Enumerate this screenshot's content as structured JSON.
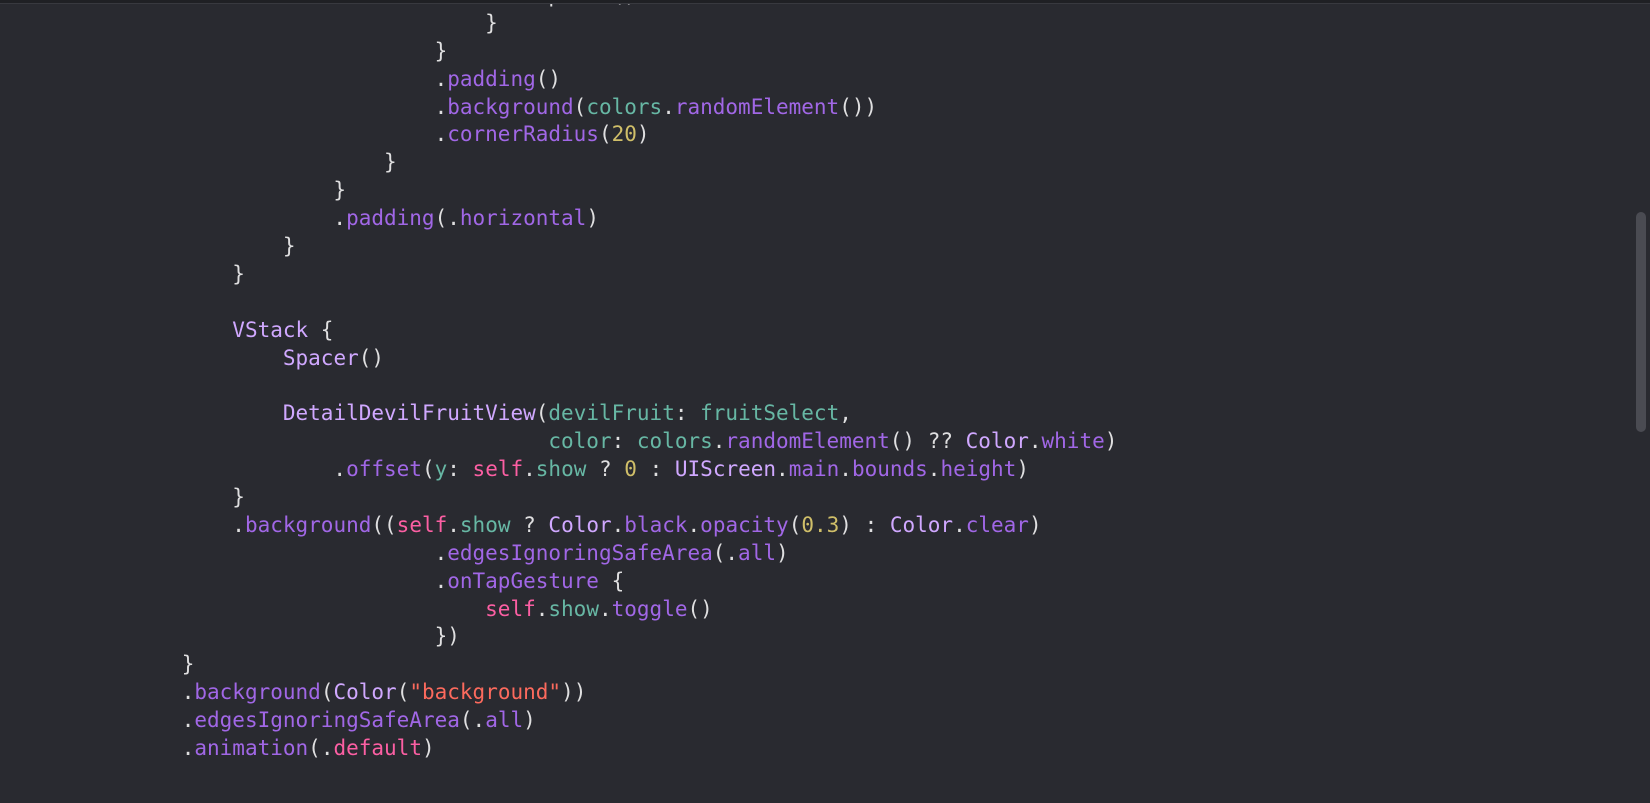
{
  "code": {
    "lines": [
      [
        [
          "w",
          "                                        Spacer()"
        ]
      ],
      [
        [
          "w",
          "                                    }"
        ]
      ],
      [
        [
          "w",
          "                                }"
        ]
      ],
      [
        [
          "w",
          "                                ."
        ],
        [
          "fn",
          "padding"
        ],
        [
          "w",
          "()"
        ]
      ],
      [
        [
          "w",
          "                                ."
        ],
        [
          "fn",
          "background"
        ],
        [
          "w",
          "("
        ],
        [
          "id",
          "colors"
        ],
        [
          "w",
          "."
        ],
        [
          "fn",
          "randomElement"
        ],
        [
          "w",
          "())"
        ]
      ],
      [
        [
          "w",
          "                                ."
        ],
        [
          "fn",
          "cornerRadius"
        ],
        [
          "w",
          "("
        ],
        [
          "nm",
          "20"
        ],
        [
          "w",
          ")"
        ]
      ],
      [
        [
          "w",
          "                            }"
        ]
      ],
      [
        [
          "w",
          "                        }"
        ]
      ],
      [
        [
          "w",
          "                        ."
        ],
        [
          "fn",
          "padding"
        ],
        [
          "w",
          "(."
        ],
        [
          "fn",
          "horizontal"
        ],
        [
          "w",
          ")"
        ]
      ],
      [
        [
          "w",
          "                    }"
        ]
      ],
      [
        [
          "w",
          "                }"
        ]
      ],
      [
        [
          "w",
          ""
        ]
      ],
      [
        [
          "w",
          "                "
        ],
        [
          "ty",
          "VStack"
        ],
        [
          "w",
          " {"
        ]
      ],
      [
        [
          "w",
          "                    "
        ],
        [
          "ty",
          "Spacer"
        ],
        [
          "w",
          "()"
        ]
      ],
      [
        [
          "w",
          ""
        ]
      ],
      [
        [
          "w",
          "                    "
        ],
        [
          "ty",
          "DetailDevilFruitView"
        ],
        [
          "w",
          "("
        ],
        [
          "id",
          "devilFruit"
        ],
        [
          "w",
          ": "
        ],
        [
          "id",
          "fruitSelect"
        ],
        [
          "w",
          ","
        ]
      ],
      [
        [
          "w",
          "                                         "
        ],
        [
          "id",
          "color"
        ],
        [
          "w",
          ": "
        ],
        [
          "id",
          "colors"
        ],
        [
          "w",
          "."
        ],
        [
          "fn",
          "randomElement"
        ],
        [
          "w",
          "() ?? "
        ],
        [
          "ty",
          "Color"
        ],
        [
          "w",
          "."
        ],
        [
          "fn",
          "white"
        ],
        [
          "w",
          ")"
        ]
      ],
      [
        [
          "w",
          "                        ."
        ],
        [
          "fn",
          "offset"
        ],
        [
          "w",
          "("
        ],
        [
          "id",
          "y"
        ],
        [
          "w",
          ": "
        ],
        [
          "kw",
          "self"
        ],
        [
          "w",
          "."
        ],
        [
          "id",
          "show"
        ],
        [
          "w",
          " ? "
        ],
        [
          "nm",
          "0"
        ],
        [
          "w",
          " : "
        ],
        [
          "ty",
          "UIScreen"
        ],
        [
          "w",
          "."
        ],
        [
          "fn",
          "main"
        ],
        [
          "w",
          "."
        ],
        [
          "fn",
          "bounds"
        ],
        [
          "w",
          "."
        ],
        [
          "fn",
          "height"
        ],
        [
          "w",
          ")"
        ]
      ],
      [
        [
          "w",
          "                }"
        ]
      ],
      [
        [
          "w",
          "                ."
        ],
        [
          "fn",
          "background"
        ],
        [
          "w",
          "(("
        ],
        [
          "kw",
          "self"
        ],
        [
          "w",
          "."
        ],
        [
          "id",
          "show"
        ],
        [
          "w",
          " ? "
        ],
        [
          "ty",
          "Color"
        ],
        [
          "w",
          "."
        ],
        [
          "fn",
          "black"
        ],
        [
          "w",
          "."
        ],
        [
          "fn",
          "opacity"
        ],
        [
          "w",
          "("
        ],
        [
          "nm",
          "0.3"
        ],
        [
          "w",
          ") : "
        ],
        [
          "ty",
          "Color"
        ],
        [
          "w",
          "."
        ],
        [
          "fn",
          "clear"
        ],
        [
          "w",
          ")"
        ]
      ],
      [
        [
          "w",
          "                                ."
        ],
        [
          "fn",
          "edgesIgnoringSafeArea"
        ],
        [
          "w",
          "(."
        ],
        [
          "fn",
          "all"
        ],
        [
          "w",
          ")"
        ]
      ],
      [
        [
          "w",
          "                                ."
        ],
        [
          "fn",
          "onTapGesture"
        ],
        [
          "w",
          " {"
        ]
      ],
      [
        [
          "w",
          "                                    "
        ],
        [
          "kw",
          "self"
        ],
        [
          "w",
          "."
        ],
        [
          "id",
          "show"
        ],
        [
          "w",
          "."
        ],
        [
          "fn",
          "toggle"
        ],
        [
          "w",
          "()"
        ]
      ],
      [
        [
          "w",
          "                                })"
        ]
      ],
      [
        [
          "w",
          "            }"
        ]
      ],
      [
        [
          "w",
          "            ."
        ],
        [
          "fn",
          "background"
        ],
        [
          "w",
          "("
        ],
        [
          "ty",
          "Color"
        ],
        [
          "w",
          "("
        ],
        [
          "st",
          "\"background\""
        ],
        [
          "w",
          "))"
        ]
      ],
      [
        [
          "w",
          "            ."
        ],
        [
          "fn",
          "edgesIgnoringSafeArea"
        ],
        [
          "w",
          "(."
        ],
        [
          "fn",
          "all"
        ],
        [
          "w",
          ")"
        ]
      ],
      [
        [
          "w",
          "            ."
        ],
        [
          "fn",
          "animation"
        ],
        [
          "w",
          "(."
        ],
        [
          "kw",
          "default"
        ],
        [
          "w",
          ")"
        ]
      ]
    ]
  }
}
